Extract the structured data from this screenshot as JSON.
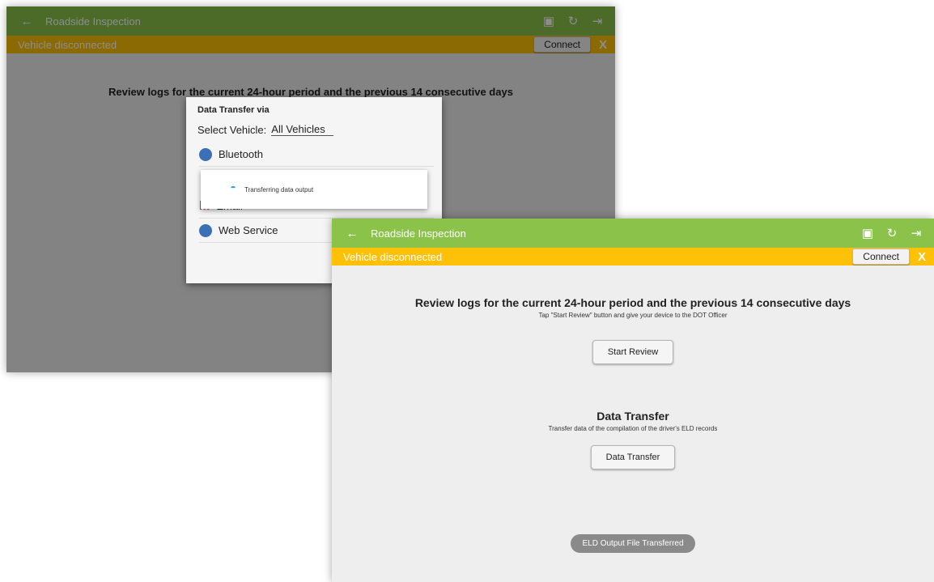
{
  "app": {
    "title": "Roadside Inspection",
    "back_icon": "arrow-left-icon",
    "icons": [
      "monitor-icon",
      "refresh-icon",
      "logout-icon"
    ],
    "accent": "#8bc34a",
    "status_color": "#ffc107"
  },
  "status": {
    "message": "Vehicle disconnected",
    "connect_label": "Connect",
    "close_label": "X"
  },
  "review": {
    "heading": "Review logs for the current 24-hour period and the previous 14 consecutive days",
    "subtext": "Tap \"Start Review\" button and give your device to the DOT Officer",
    "button": "Start Review"
  },
  "transfer": {
    "heading": "Data Transfer",
    "subtext": "Transfer data of the compilation of the driver's ELD records",
    "button": "Data Transfer"
  },
  "toast": "ELD Output File Transferred",
  "dialog": {
    "title": "Data Transfer via",
    "select_label": "Select Vehicle:",
    "select_value": "All Vehicles",
    "options": [
      "Bluetooth",
      "Email",
      "Web Service"
    ],
    "progress_text": "Transferring data output"
  }
}
